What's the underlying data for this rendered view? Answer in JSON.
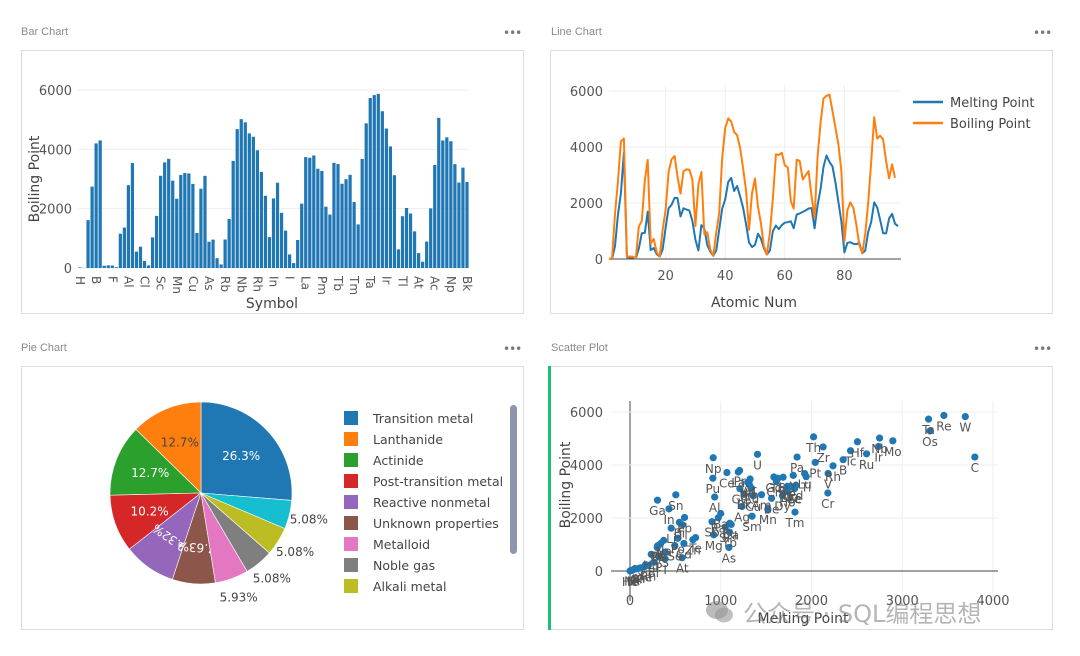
{
  "panels": {
    "bar": {
      "title": "Bar Chart",
      "menu": "•••"
    },
    "line": {
      "title": "Line Chart",
      "menu": "•••"
    },
    "pie": {
      "title": "Pie Chart",
      "menu": "•••"
    },
    "scatter": {
      "title": "Scatter Plot",
      "menu": "•••"
    }
  },
  "watermark": "公众号 · SQL编程思想",
  "colors": {
    "blue": "#1f77b4",
    "orange": "#ff7f0e",
    "grid": "#eeeeee",
    "accent_green": "#1fbf7a"
  },
  "chart_data": [
    {
      "type": "bar",
      "xlabel": "Symbol",
      "ylabel": "Boiling Point",
      "ylim": [
        0,
        6000
      ],
      "yticks": [
        0,
        2000,
        4000,
        6000
      ],
      "xtick_labels": [
        "H",
        "B",
        "F",
        "Al",
        "Cl",
        "Sc",
        "Mn",
        "Cu",
        "As",
        "Rb",
        "Nb",
        "Rh",
        "In",
        "I",
        "La",
        "Pm",
        "Tb",
        "Tm",
        "Ta",
        "Ir",
        "Tl",
        "At",
        "Ac",
        "Np",
        "Bk"
      ],
      "categories": [
        "H",
        "He",
        "Li",
        "Be",
        "B",
        "C",
        "N",
        "O",
        "F",
        "Ne",
        "Na",
        "Mg",
        "Al",
        "Si",
        "P",
        "S",
        "Cl",
        "Ar",
        "K",
        "Ca",
        "Sc",
        "Ti",
        "V",
        "Cr",
        "Mn",
        "Fe",
        "Co",
        "Ni",
        "Cu",
        "Zn",
        "Ga",
        "Ge",
        "As",
        "Se",
        "Br",
        "Kr",
        "Rb",
        "Sr",
        "Y",
        "Zr",
        "Nb",
        "Mo",
        "Tc",
        "Ru",
        "Rh",
        "Pd",
        "Ag",
        "Cd",
        "In",
        "Sn",
        "Sb",
        "Te",
        "I",
        "Xe",
        "Cs",
        "Ba",
        "La",
        "Ce",
        "Pr",
        "Nd",
        "Pm",
        "Sm",
        "Eu",
        "Gd",
        "Tb",
        "Dy",
        "Ho",
        "Er",
        "Tm",
        "Yb",
        "Lu",
        "Hf",
        "Ta",
        "W",
        "Re",
        "Os",
        "Ir",
        "Pt",
        "Au",
        "Hg",
        "Tl",
        "Pb",
        "Bi",
        "Po",
        "At",
        "Rn",
        "Fr",
        "Ra",
        "Ac",
        "Th",
        "Pa",
        "U",
        "Np",
        "Pu",
        "Am",
        "Cm",
        "Bk"
      ],
      "values": [
        20,
        4,
        1615,
        2743,
        4200,
        4300,
        77,
        90,
        85,
        27,
        1156,
        1363,
        2792,
        3538,
        553,
        718,
        239,
        87,
        1032,
        1757,
        3109,
        3560,
        3680,
        2944,
        2334,
        3134,
        3200,
        3186,
        2835,
        1180,
        2673,
        3106,
        887,
        958,
        332,
        120,
        961,
        1655,
        3609,
        4682,
        5017,
        4912,
        4538,
        4423,
        3968,
        3236,
        2435,
        1040,
        2345,
        2875,
        1860,
        1261,
        457,
        165,
        944,
        2170,
        3737,
        3716,
        3793,
        3347,
        3273,
        2067,
        1802,
        3546,
        3503,
        2840,
        2993,
        3141,
        2223,
        1469,
        3675,
        4876,
        5731,
        5828,
        5869,
        5285,
        4701,
        4098,
        3129,
        630,
        1746,
        2022,
        1837,
        1235,
        503,
        211,
        890,
        2010,
        3471,
        5061,
        4300,
        4404,
        4273,
        3501,
        2880,
        3383,
        2900
      ],
      "grid": true
    },
    {
      "type": "line",
      "xlabel": "Atomic Num",
      "ylabel": "",
      "xticks": [
        20,
        40,
        60,
        80
      ],
      "yticks": [
        0,
        2000,
        4000,
        6000
      ],
      "xlim": [
        1,
        99
      ],
      "ylim": [
        0,
        6000
      ],
      "legend": "top-right",
      "grid": true,
      "series": [
        {
          "name": "Melting Point",
          "color": "#1f77b4",
          "values": [
            14,
            1,
            454,
            1560,
            2349,
            3800,
            63,
            54,
            53,
            25,
            371,
            923,
            933,
            1687,
            317,
            388,
            172,
            84,
            337,
            1115,
            1814,
            1941,
            2183,
            2180,
            1519,
            1811,
            1768,
            1728,
            1358,
            693,
            303,
            1211,
            1090,
            494,
            266,
            116,
            312,
            1050,
            1799,
            2128,
            2750,
            2896,
            2430,
            2607,
            2237,
            1828,
            1235,
            594,
            430,
            505,
            904,
            723,
            387,
            161,
            302,
            1000,
            1193,
            1068,
            1208,
            1297,
            1315,
            1345,
            1099,
            1585,
            1629,
            1680,
            1734,
            1802,
            1818,
            1097,
            1925,
            2506,
            3290,
            3695,
            3459,
            3306,
            2739,
            2041,
            1337,
            234,
            577,
            601,
            544,
            527,
            575,
            202,
            300,
            973,
            1323,
            2023,
            1841,
            1405,
            917,
            913,
            1449,
            1613,
            1259,
            1173
          ]
        },
        {
          "name": "Boiling Point",
          "color": "#ff7f0e",
          "values": [
            20,
            4,
            1615,
            2743,
            4200,
            4300,
            77,
            90,
            85,
            27,
            1156,
            1363,
            2792,
            3538,
            553,
            718,
            239,
            87,
            1032,
            1757,
            3109,
            3560,
            3680,
            2944,
            2334,
            3134,
            3200,
            3186,
            2835,
            1180,
            2673,
            3106,
            887,
            958,
            332,
            120,
            961,
            1655,
            3609,
            4682,
            5017,
            4912,
            4538,
            4423,
            3968,
            3236,
            2435,
            1040,
            2345,
            2875,
            1860,
            1261,
            457,
            165,
            944,
            2170,
            3737,
            3716,
            3793,
            3347,
            3273,
            2067,
            1802,
            3546,
            3503,
            2840,
            2993,
            3141,
            2223,
            1469,
            3675,
            4876,
            5731,
            5828,
            5869,
            5285,
            4701,
            4098,
            3129,
            630,
            1746,
            2022,
            1837,
            1235,
            503,
            211,
            890,
            2010,
            3471,
            5061,
            4300,
            4404,
            4273,
            3501,
            2880,
            3383,
            2900
          ]
        }
      ]
    },
    {
      "type": "pie",
      "legend": "right",
      "slices": [
        {
          "label": "Transition metal",
          "value": 26.3,
          "text": "26.3%",
          "color": "#1f77b4"
        },
        {
          "label": "Lanthanide",
          "value": 12.7,
          "text": "12.7%",
          "color": "#ff7f0e"
        },
        {
          "label": "Actinide",
          "value": 12.7,
          "text": "12.7%",
          "color": "#2ca02c"
        },
        {
          "label": "Post-transition metal",
          "value": 10.2,
          "text": "10.2%",
          "color": "#d62728"
        },
        {
          "label": "Reactive nonmetal",
          "value": 9.32,
          "text": "9.32%",
          "color": "#9467bd"
        },
        {
          "label": "Unknown properties",
          "value": 7.63,
          "text": "7.63%",
          "color": "#8c564b"
        },
        {
          "label": "Metalloid",
          "value": 5.93,
          "text": "5.93%",
          "color": "#e377c2"
        },
        {
          "label": "Noble gas",
          "value": 5.08,
          "text": "5.08%",
          "color": "#7f7f7f"
        },
        {
          "label": "Alkali metal",
          "value": 5.08,
          "text": "5.08%",
          "color": "#bcbd22"
        },
        {
          "label": "",
          "value": 5.08,
          "text": "5.08%",
          "color": "#17becf"
        }
      ]
    },
    {
      "type": "scatter",
      "xlabel": "Melting Point",
      "ylabel": "Boiling Point",
      "xticks": [
        0,
        1000,
        2000,
        3000,
        4000
      ],
      "yticks": [
        0,
        2000,
        4000,
        6000
      ],
      "grid": true,
      "color": "#1f77b4",
      "labels": [
        "H",
        "He",
        "Li",
        "Be",
        "B",
        "C",
        "N",
        "O",
        "F",
        "Ne",
        "Na",
        "Mg",
        "Al",
        "Si",
        "P",
        "S",
        "Cl",
        "Ar",
        "K",
        "Ca",
        "Sc",
        "Ti",
        "V",
        "Cr",
        "Mn",
        "Fe",
        "Co",
        "Ni",
        "Cu",
        "Zn",
        "Ga",
        "Ge",
        "As",
        "Se",
        "Br",
        "Kr",
        "Rb",
        "Sr",
        "Y",
        "Zr",
        "Nb",
        "Mo",
        "Tc",
        "Ru",
        "Rh",
        "Pd",
        "Ag",
        "Cd",
        "In",
        "Sn",
        "Sb",
        "Te",
        "I",
        "Xe",
        "Cs",
        "Ba",
        "La",
        "Ce",
        "Pr",
        "Nd",
        "Pm",
        "Sm",
        "Eu",
        "Gd",
        "Tb",
        "Dy",
        "Ho",
        "Er",
        "Tm",
        "Yb",
        "Lu",
        "Hf",
        "Ta",
        "W",
        "Re",
        "Os",
        "Ir",
        "Pt",
        "Au",
        "Hg",
        "Tl",
        "Pb",
        "Bi",
        "Po",
        "At",
        "Rn",
        "Fr",
        "Ra",
        "Ac",
        "Th",
        "Pa",
        "U",
        "Np",
        "Pu",
        "Am",
        "Cm",
        "Bk"
      ],
      "x": [
        14,
        1,
        454,
        1560,
        2349,
        3800,
        63,
        54,
        53,
        25,
        371,
        923,
        933,
        1687,
        317,
        388,
        172,
        84,
        337,
        1115,
        1814,
        1941,
        2183,
        2180,
        1519,
        1811,
        1768,
        1728,
        1358,
        693,
        303,
        1211,
        1090,
        494,
        266,
        116,
        312,
        1050,
        1799,
        2128,
        2750,
        2896,
        2430,
        2607,
        2237,
        1828,
        1235,
        594,
        430,
        505,
        904,
        723,
        387,
        161,
        302,
        1000,
        1193,
        1068,
        1208,
        1297,
        1315,
        1345,
        1099,
        1585,
        1629,
        1680,
        1734,
        1802,
        1818,
        1097,
        1925,
        2506,
        3290,
        3695,
        3459,
        3306,
        2739,
        2041,
        1337,
        234,
        577,
        601,
        544,
        527,
        575,
        202,
        300,
        973,
        1323,
        2023,
        1841,
        1405,
        917,
        913,
        1449,
        1613,
        1259
      ],
      "y": [
        20,
        4,
        1615,
        2743,
        4200,
        4300,
        77,
        90,
        85,
        27,
        1156,
        1363,
        2792,
        3538,
        553,
        718,
        239,
        87,
        1032,
        1757,
        3109,
        3560,
        3680,
        2944,
        2334,
        3134,
        3200,
        3186,
        2835,
        1180,
        2673,
        3106,
        887,
        958,
        332,
        120,
        961,
        1655,
        3609,
        4682,
        5017,
        4912,
        4538,
        4423,
        3968,
        3236,
        2435,
        1040,
        2345,
        2875,
        1860,
        1261,
        457,
        165,
        944,
        2170,
        3737,
        3716,
        3793,
        3347,
        3273,
        2067,
        1802,
        3546,
        3503,
        2840,
        2993,
        3141,
        2223,
        1469,
        3675,
        4876,
        5731,
        5828,
        5869,
        5285,
        4701,
        4098,
        3129,
        630,
        1746,
        2022,
        1837,
        1235,
        503,
        211,
        890,
        2010,
        3471,
        5061,
        4300,
        4404,
        4273,
        3501,
        2880,
        3383,
        2900
      ]
    }
  ]
}
